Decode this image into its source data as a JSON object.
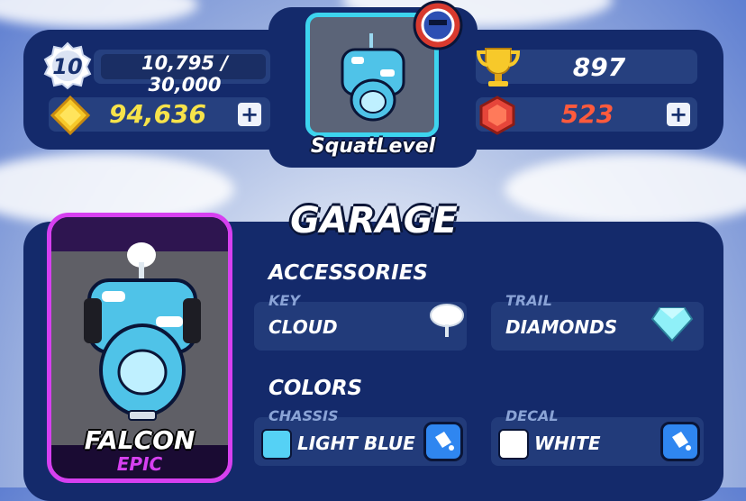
{
  "player": {
    "level": "10",
    "xp_text": "10,795 / 30,000",
    "xp_progress": 0.36,
    "name": "SquatLevel"
  },
  "currencies": {
    "coins": "94,636",
    "trophies": "897",
    "gems": "523"
  },
  "garage": {
    "title": "GARAGE",
    "car": {
      "name": "FALCON",
      "rarity": "EPIC"
    },
    "accessories_title": "ACCESSORIES",
    "key": {
      "label": "KEY",
      "value": "CLOUD",
      "icon": "cloud-icon"
    },
    "trail": {
      "label": "TRAIL",
      "value": "DIAMONDS",
      "icon": "diamond-icon"
    },
    "colors_title": "COLORS",
    "chassis": {
      "label": "CHASSIS",
      "value": "LIGHT BLUE",
      "swatch": "#55d1f5"
    },
    "decal": {
      "label": "DECAL",
      "value": "WHITE",
      "swatch": "#ffffff"
    }
  },
  "colors": {
    "coin_text": "#f7e34a",
    "gem_text": "#ff5a3c",
    "epic": "#d640f0",
    "panel": "#142a6b"
  }
}
